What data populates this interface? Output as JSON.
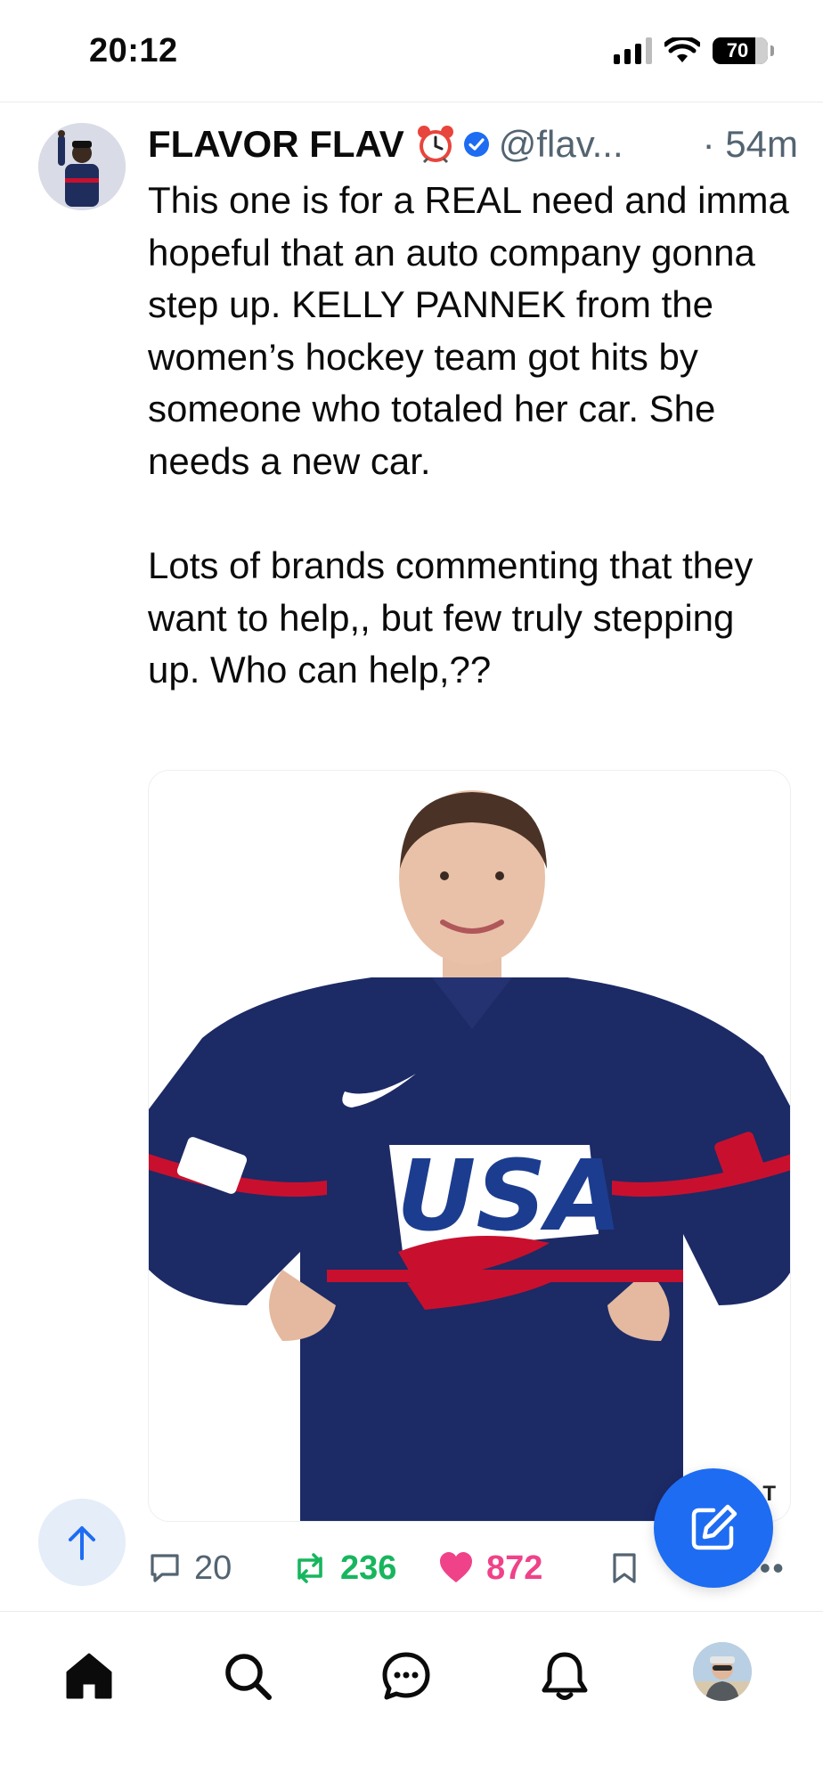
{
  "status_bar": {
    "time": "20:12",
    "battery": "70",
    "icons": [
      "cellular-signal-icon",
      "wifi-icon",
      "battery-icon"
    ]
  },
  "tweet": {
    "display_name": "FLAVOR FLAV",
    "name_emoji": "alarm-clock-icon",
    "verified": true,
    "handle": "@flav...",
    "time_ago": "· 54m",
    "text": "This one is for a REAL need and imma hopeful that an auto company gonna step up. KELLY PANNEK from the women’s hockey team got hits by someone who totaled her car. She needs a new car.\n\nLots of brands commenting that they want to help,, but few truly stepping up. Who can help,??",
    "media": {
      "description_icon": "photo-hockey-player",
      "jersey_text": "USA",
      "badge": "T"
    },
    "actions": {
      "replies": "20",
      "retweets": "236",
      "likes": "872"
    }
  },
  "colors": {
    "accent": "#1d6cf2",
    "retweet": "#17b65e",
    "like": "#ef4289",
    "muted": "#536471"
  },
  "tabbar": {
    "items": [
      "home-icon",
      "search-icon",
      "messages-icon",
      "notifications-icon",
      "profile-avatar"
    ]
  }
}
